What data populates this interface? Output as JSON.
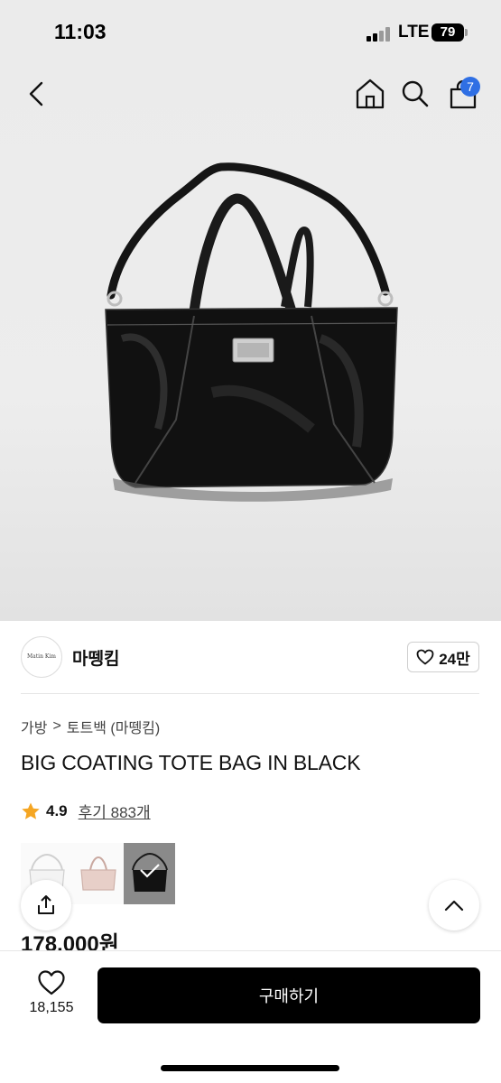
{
  "status_bar": {
    "time": "11:03",
    "network": "LTE",
    "battery": "79"
  },
  "header": {
    "cart_count": "7"
  },
  "brand": {
    "logo_text": "Matin Kim",
    "name": "마뗑킴",
    "likes": "24만"
  },
  "breadcrumb": {
    "category": "가방",
    "separator": ">",
    "subcategory": "토트백 (마뗑킴)"
  },
  "product": {
    "title": "BIG COATING TOTE BAG IN BLACK",
    "rating": "4.9",
    "reviews": "후기 883개",
    "price": "178,000원",
    "color_options": [
      "white",
      "pink",
      "black"
    ],
    "selected_color": "black"
  },
  "bottom_bar": {
    "wish_count": "18,155",
    "buy_label": "구매하기"
  },
  "colors": {
    "accent": "#2f6fe4",
    "star": "#f5a623",
    "buy_button": "#000000"
  }
}
